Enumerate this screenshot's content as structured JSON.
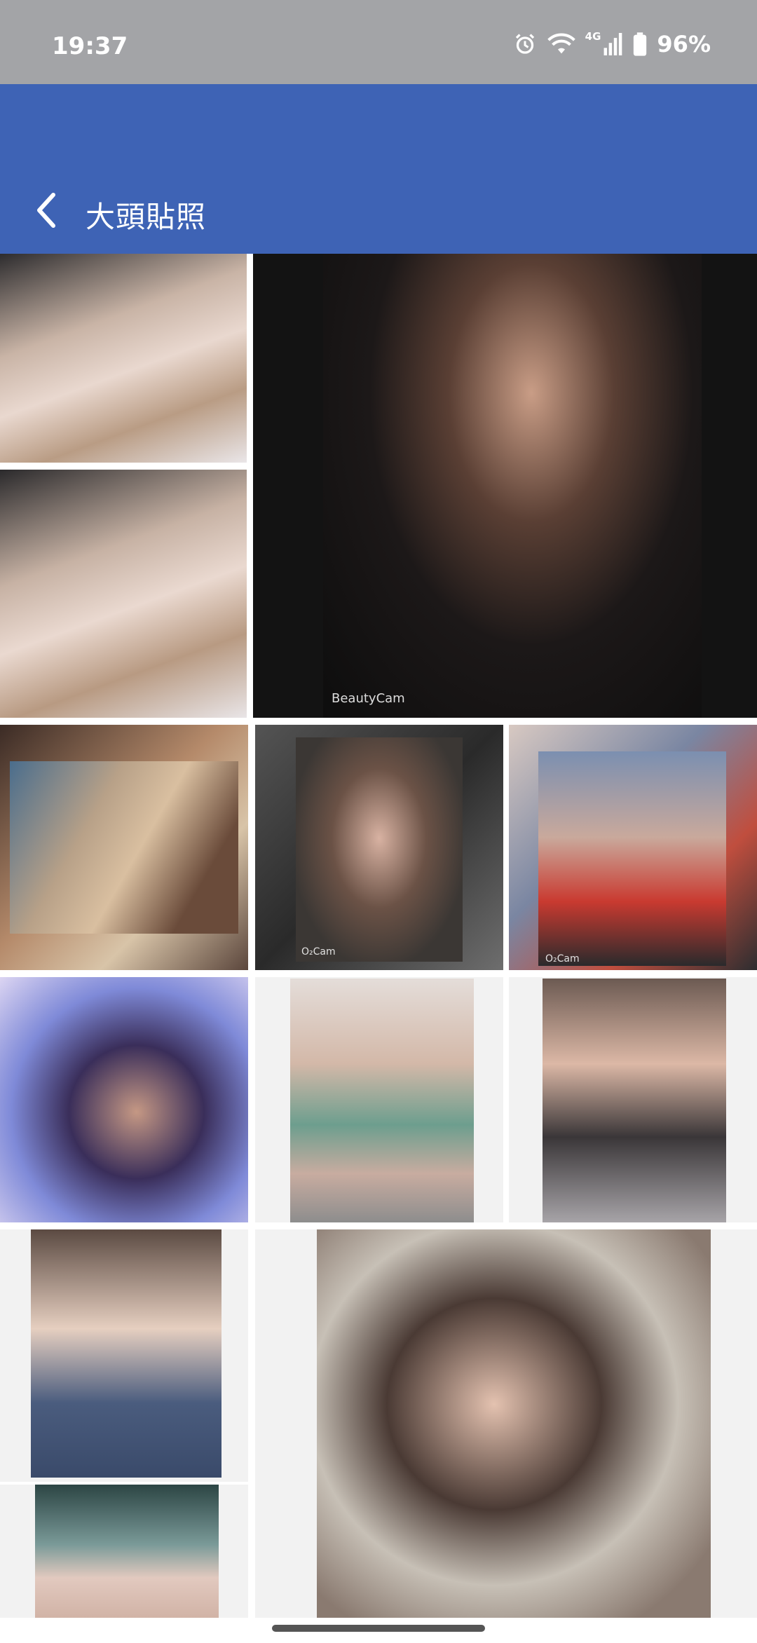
{
  "status": {
    "time": "19:37",
    "network": "4G",
    "battery": "96%"
  },
  "app_bar": {
    "title": "大頭貼照",
    "back_icon": "back-arrow-icon"
  },
  "watermarks": {
    "beautycam": "BeautyCam",
    "o2cam_1": "O₂Cam",
    "o2cam_2": "O₂Cam"
  },
  "photos_label": "profile-photo-grid"
}
